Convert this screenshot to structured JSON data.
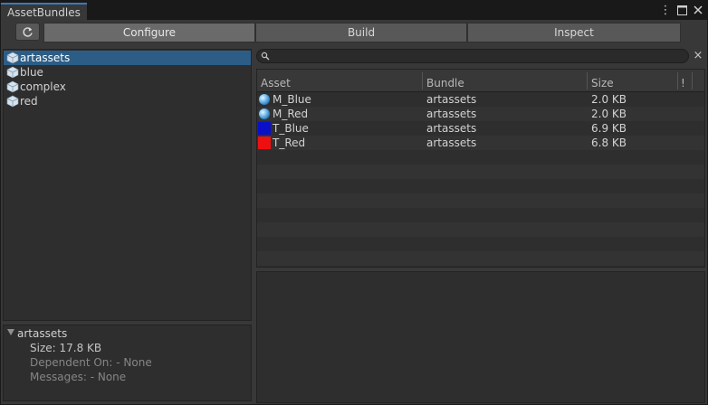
{
  "window": {
    "tab_title": "AssetBundles"
  },
  "toolbar": {
    "refresh_icon": "refresh-icon",
    "tabs": [
      "Configure",
      "Build",
      "Inspect"
    ],
    "active_tab": "Configure"
  },
  "bundles": [
    {
      "label": "artassets",
      "selected": true
    },
    {
      "label": "blue",
      "selected": false
    },
    {
      "label": "complex",
      "selected": false
    },
    {
      "label": "red",
      "selected": false
    }
  ],
  "info": {
    "name": "artassets",
    "size": "Size: 17.8 KB",
    "dependent": "Dependent On: - None",
    "messages": "Messages: - None"
  },
  "search": {
    "value": "",
    "placeholder": ""
  },
  "table": {
    "columns": {
      "asset": "Asset",
      "bundle": "Bundle",
      "size": "Size",
      "flag": "!"
    },
    "rows": [
      {
        "asset": "M_Blue",
        "bundle": "artassets",
        "size": "2.0 KB",
        "icon": "material-sphere-icon"
      },
      {
        "asset": "M_Red",
        "bundle": "artassets",
        "size": "2.0 KB",
        "icon": "material-sphere-icon"
      },
      {
        "asset": "T_Blue",
        "bundle": "artassets",
        "size": "6.9 KB",
        "icon": "texture-icon",
        "color": "#0a10c8"
      },
      {
        "asset": "T_Red",
        "bundle": "artassets",
        "size": "6.8 KB",
        "icon": "texture-icon",
        "color": "#ee1010"
      }
    ]
  },
  "colors": {
    "accent": "#2c5d87",
    "background": "#383838"
  }
}
